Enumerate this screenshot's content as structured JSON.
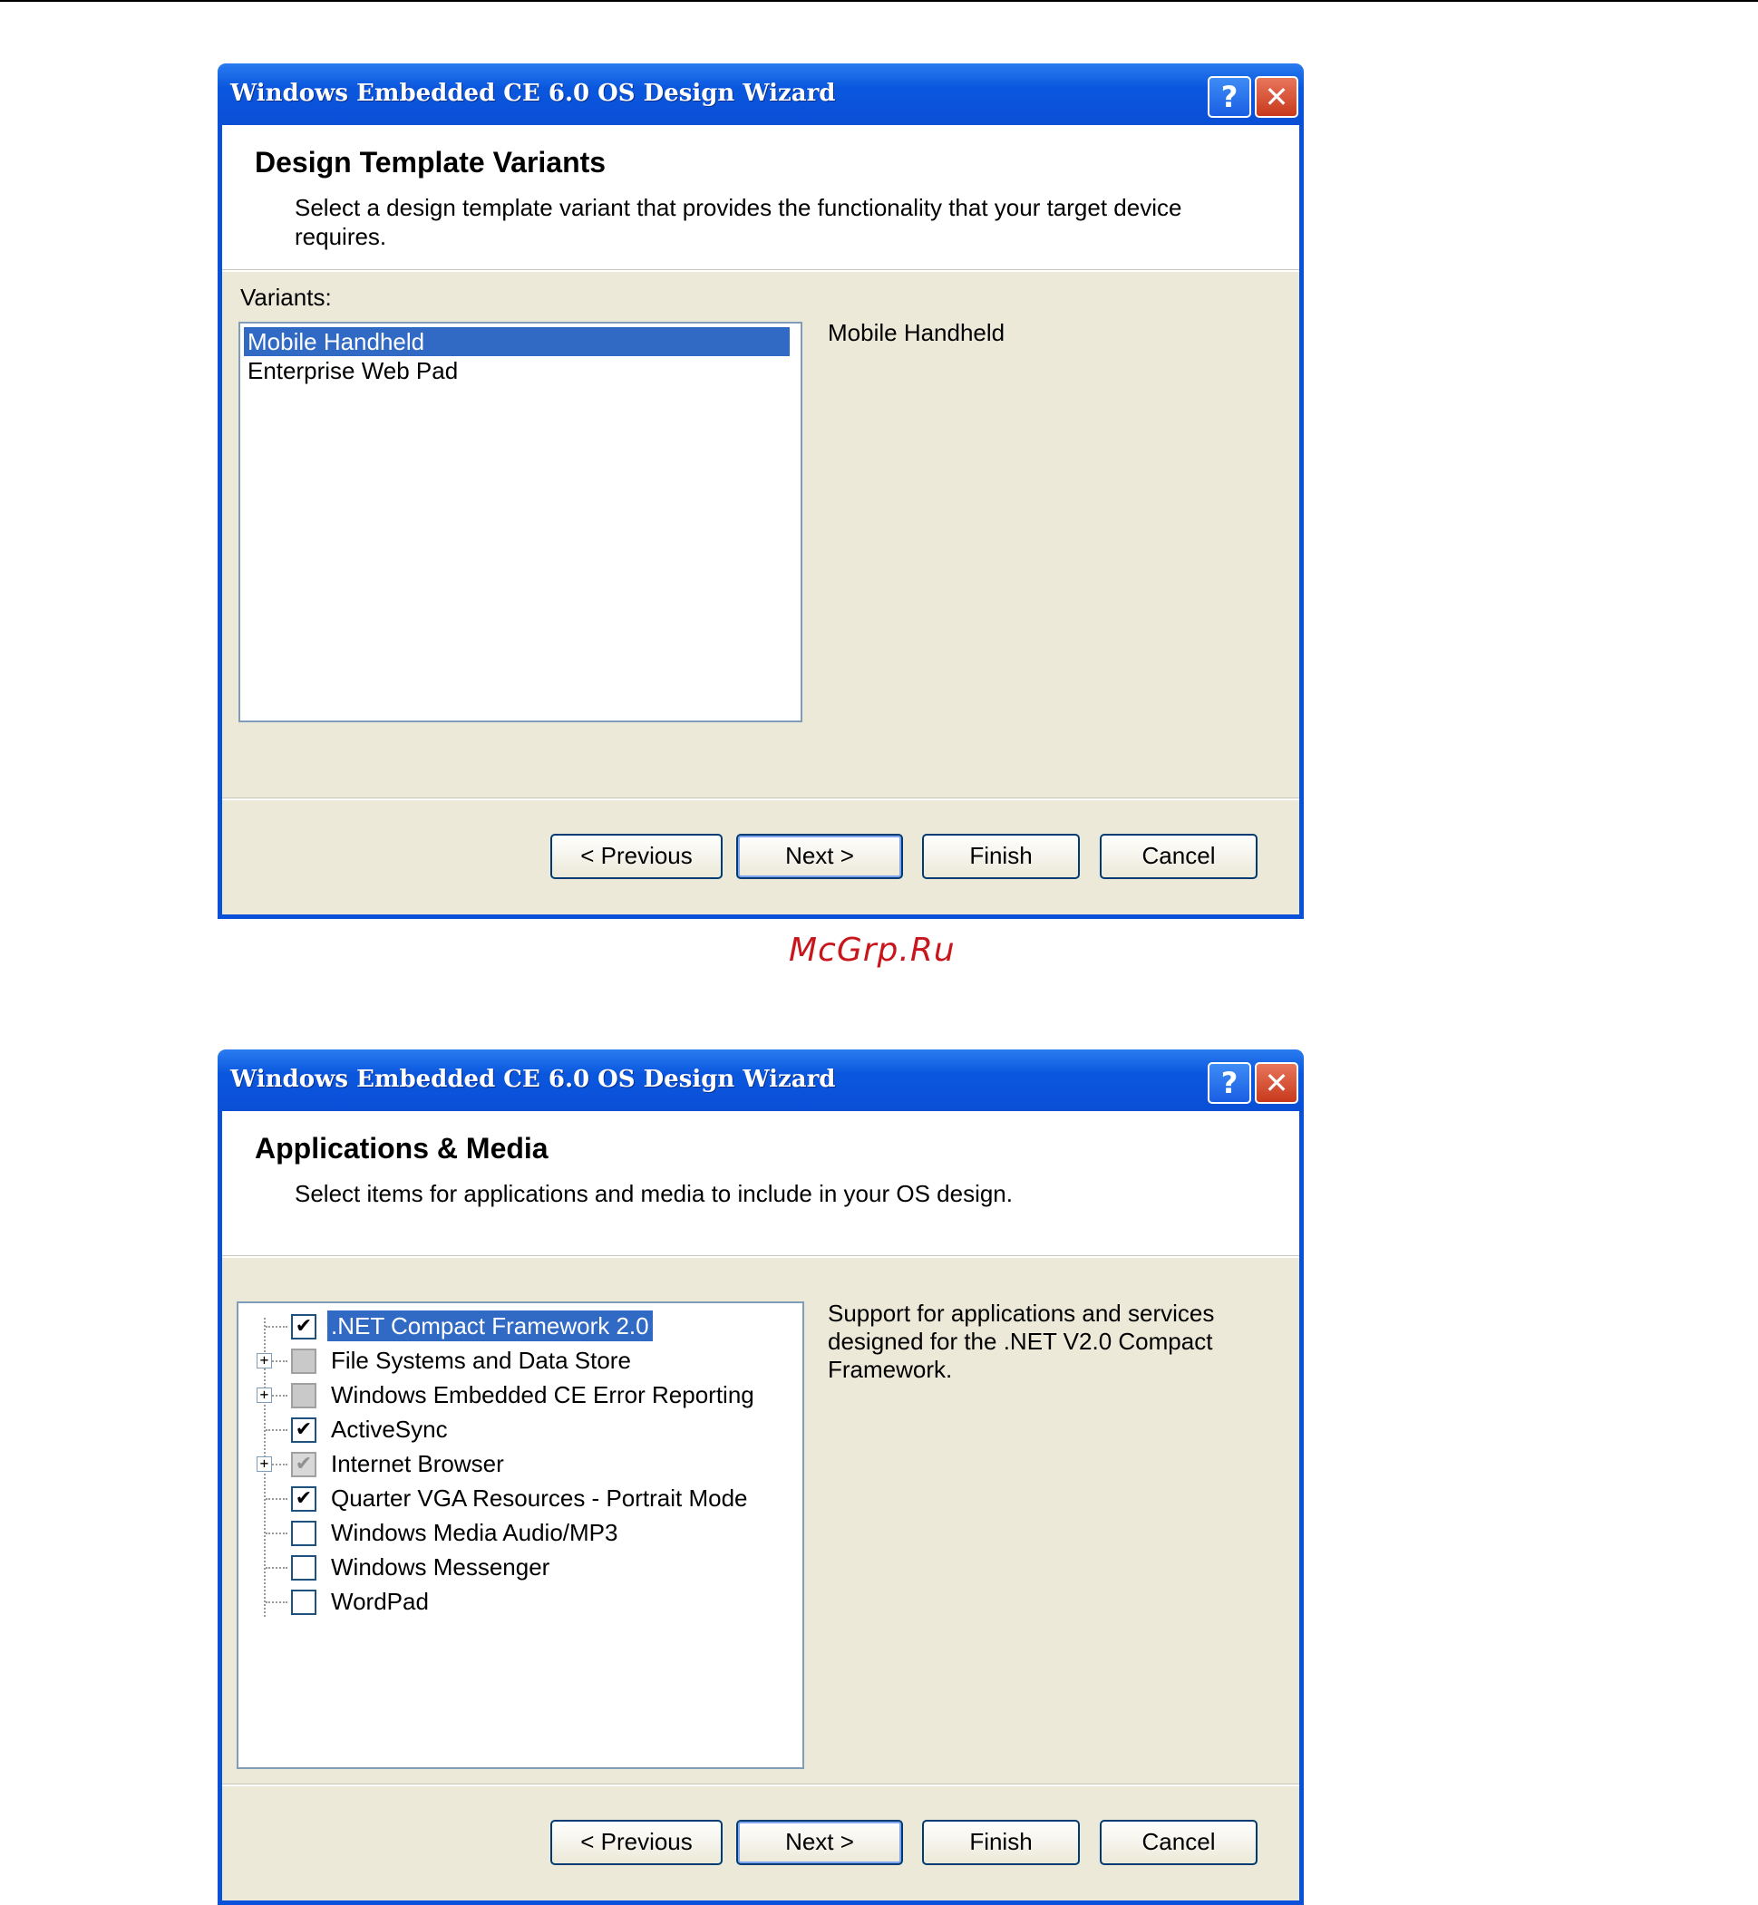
{
  "watermark": "McGrp.Ru",
  "dialog1": {
    "title": "Windows Embedded CE 6.0 OS Design Wizard",
    "help_glyph": "?",
    "close_glyph": "✕",
    "header_title": "Design Template Variants",
    "header_desc": "Select a design template variant that provides the functionality that your target device requires.",
    "variants_label": "Variants:",
    "variants": [
      "Mobile Handheld",
      "Enterprise Web Pad"
    ],
    "selected_variant_desc": "Mobile Handheld",
    "buttons": {
      "previous": "< Previous",
      "next": "Next >",
      "finish": "Finish",
      "cancel": "Cancel"
    }
  },
  "dialog2": {
    "title": "Windows Embedded CE 6.0 OS Design Wizard",
    "help_glyph": "?",
    "close_glyph": "✕",
    "header_title": "Applications & Media",
    "header_desc": "Select items for applications and media to include in your OS design.",
    "items": [
      {
        "label": ".NET Compact Framework 2.0",
        "state": "checked",
        "expandable": false,
        "selected": true
      },
      {
        "label": "File Systems and Data Store",
        "state": "grayed",
        "expandable": true,
        "selected": false
      },
      {
        "label": "Windows Embedded CE Error Reporting",
        "state": "grayed",
        "expandable": true,
        "selected": false
      },
      {
        "label": "ActiveSync",
        "state": "checked",
        "expandable": false,
        "selected": false
      },
      {
        "label": "Internet Browser",
        "state": "grayed-checked",
        "expandable": true,
        "selected": false
      },
      {
        "label": "Quarter VGA Resources - Portrait Mode",
        "state": "checked",
        "expandable": false,
        "selected": false
      },
      {
        "label": "Windows Media Audio/MP3",
        "state": "unchecked",
        "expandable": false,
        "selected": false
      },
      {
        "label": "Windows Messenger",
        "state": "unchecked",
        "expandable": false,
        "selected": false
      },
      {
        "label": "WordPad",
        "state": "unchecked",
        "expandable": false,
        "selected": false
      }
    ],
    "selected_item_desc": "Support for applications and services designed for the .NET V2.0 Compact Framework.",
    "buttons": {
      "previous": "< Previous",
      "next": "Next >",
      "finish": "Finish",
      "cancel": "Cancel"
    }
  }
}
